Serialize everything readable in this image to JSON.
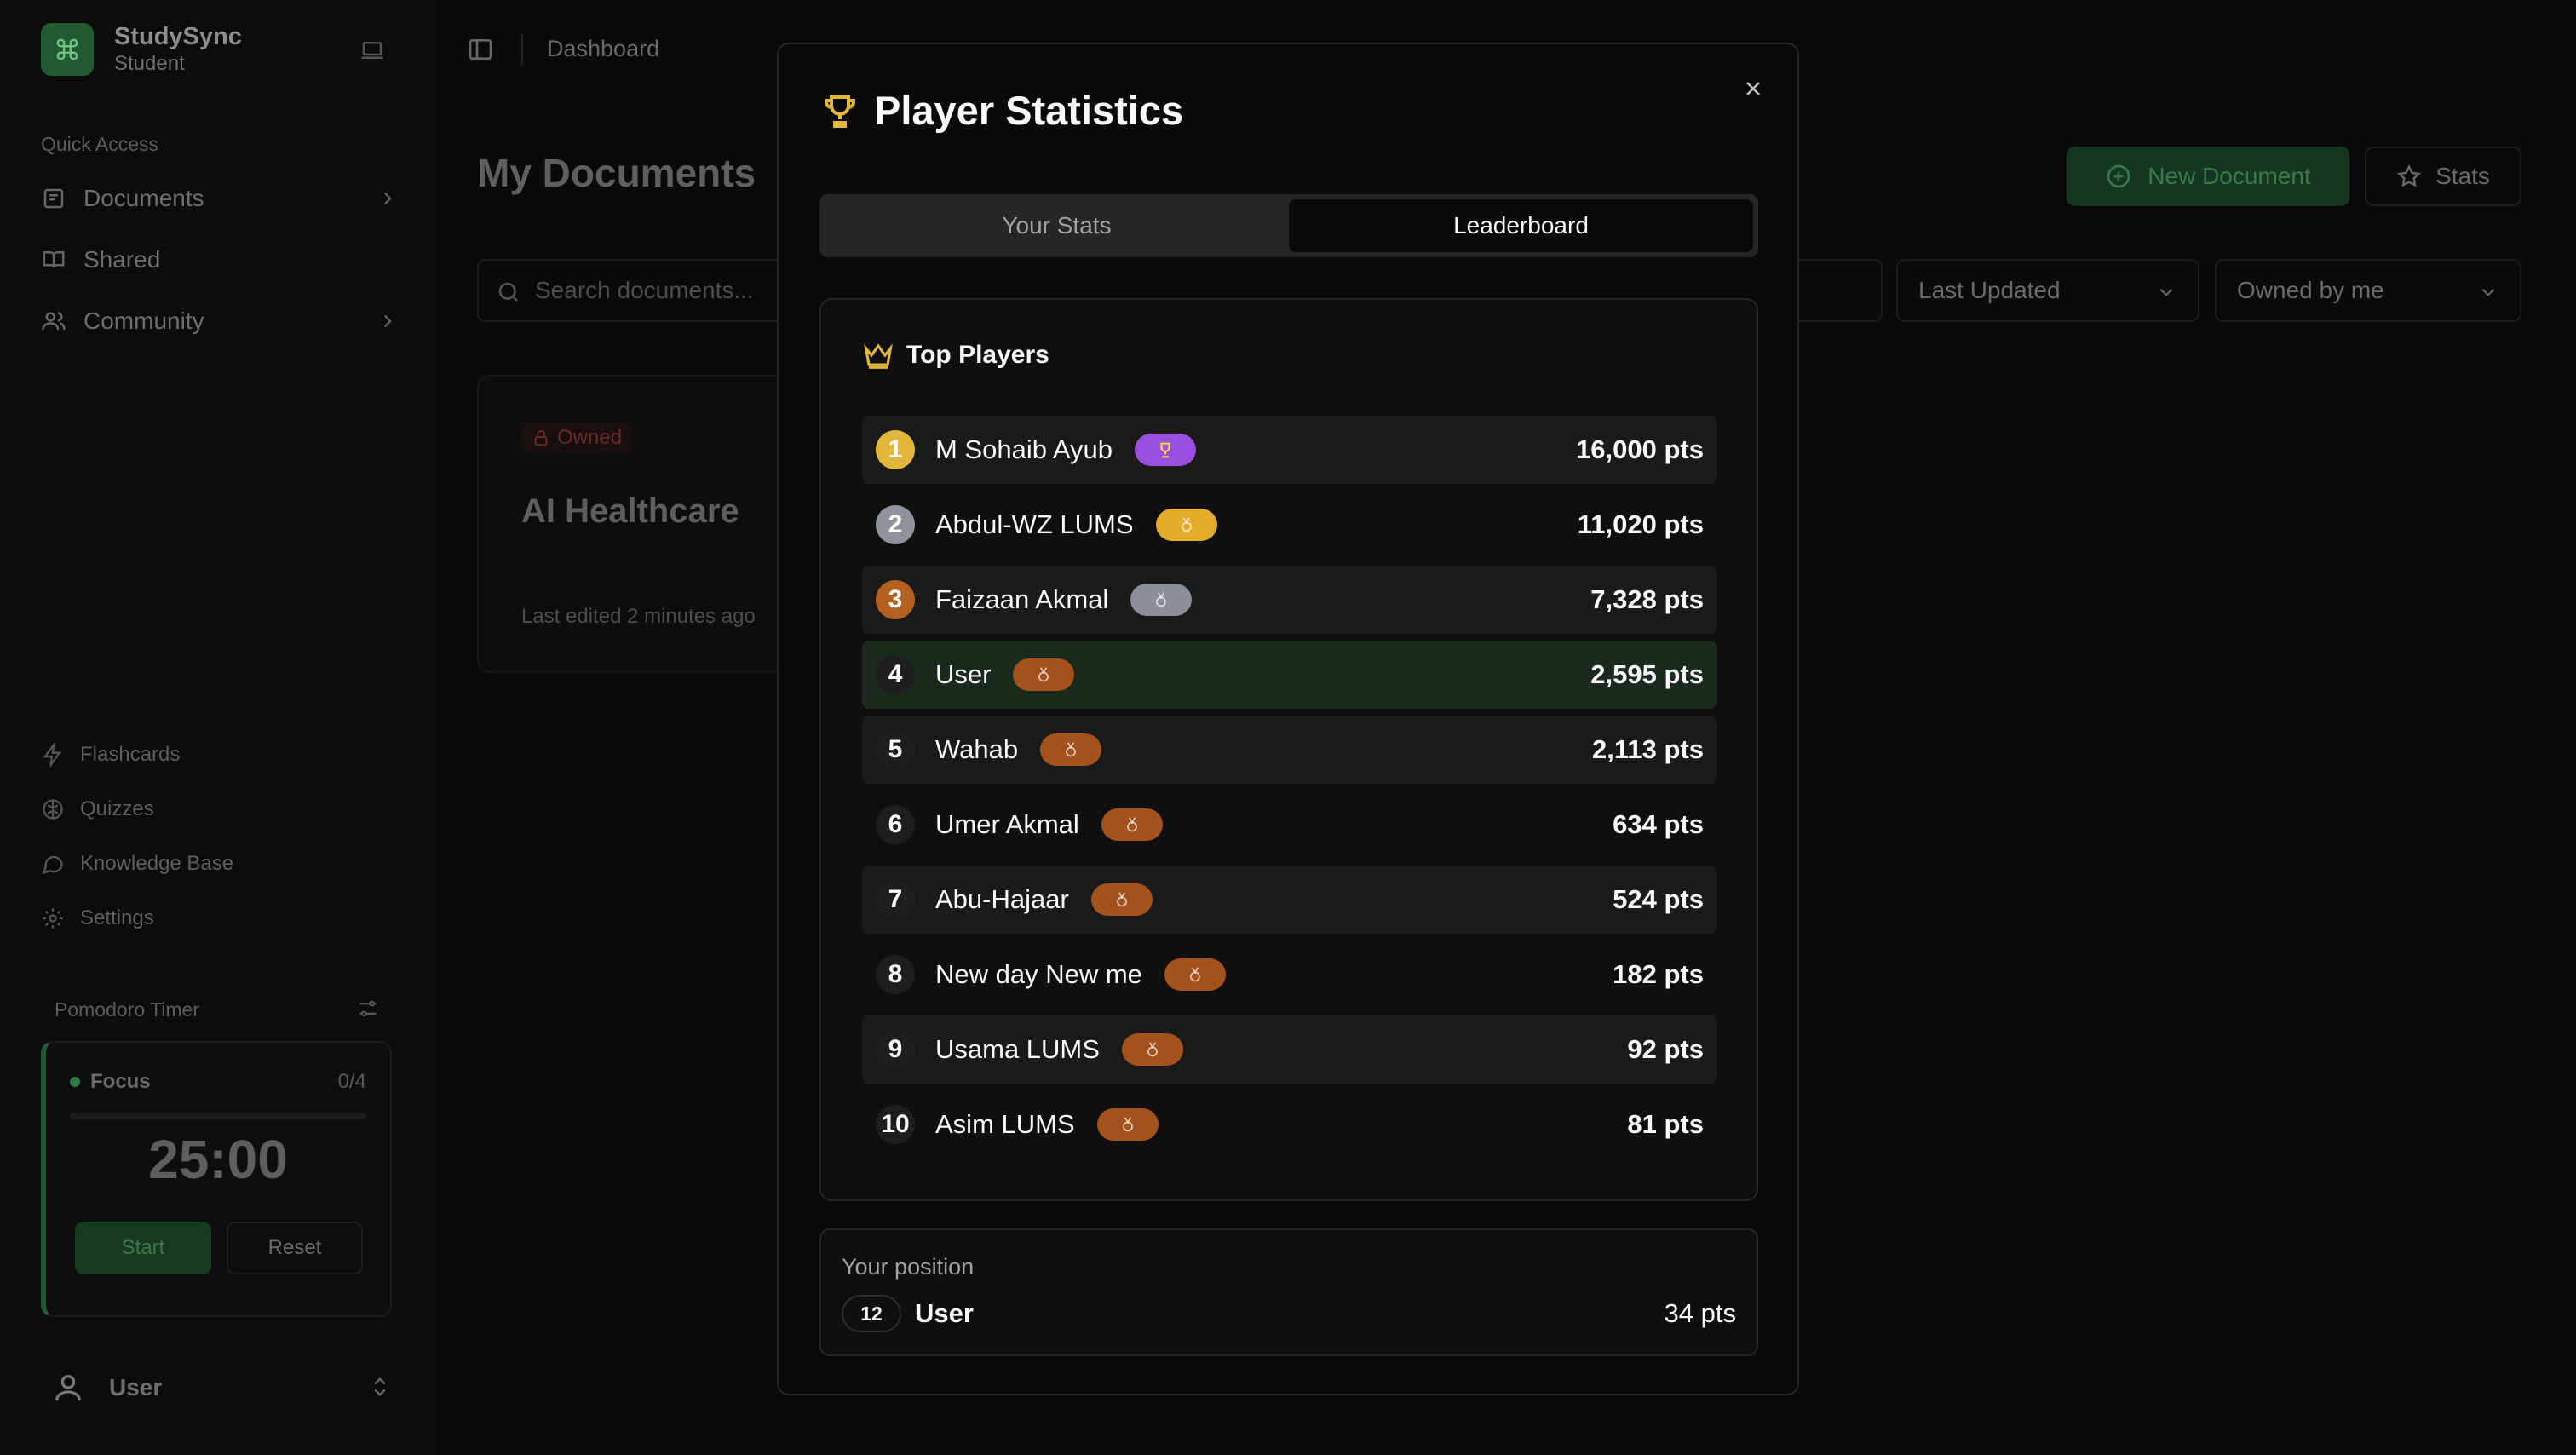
{
  "app": {
    "name": "StudySync",
    "role": "Student"
  },
  "sidebar": {
    "quick_access_label": "Quick Access",
    "nav": [
      {
        "label": "Documents"
      },
      {
        "label": "Shared"
      },
      {
        "label": "Community"
      }
    ],
    "tools": [
      {
        "label": "Flashcards"
      },
      {
        "label": "Quizzes"
      },
      {
        "label": "Knowledge Base"
      },
      {
        "label": "Settings"
      }
    ],
    "pomodoro": {
      "title": "Pomodoro Timer",
      "mode": "Focus",
      "count": "0/4",
      "time": "25:00",
      "start_label": "Start",
      "reset_label": "Reset"
    },
    "user": {
      "name": "User"
    }
  },
  "topbar": {
    "breadcrumb": "Dashboard"
  },
  "main": {
    "title": "My Documents",
    "new_document_label": "New Document",
    "stats_label": "Stats",
    "search_placeholder": "Search documents...",
    "sort_value": "Last Updated",
    "owner_filter_value": "Owned by me",
    "documents": [
      {
        "badge": "Owned",
        "title": "AI Healthcare",
        "edited": "Last edited 2 minutes ago"
      }
    ]
  },
  "modal": {
    "title": "Player Statistics",
    "tabs": [
      {
        "label": "Your Stats",
        "active": false
      },
      {
        "label": "Leaderboard",
        "active": true
      }
    ],
    "leaderboard_title": "Top Players",
    "players": [
      {
        "rank": "1",
        "name": "M Sohaib Ayub",
        "points": "16,000 pts",
        "medal": "gold",
        "badge": "purple"
      },
      {
        "rank": "2",
        "name": "Abdul-WZ LUMS",
        "points": "11,020 pts",
        "medal": "silver",
        "badge": "yellow"
      },
      {
        "rank": "3",
        "name": "Faizaan Akmal",
        "points": "7,328 pts",
        "medal": "bronze",
        "badge": "gray"
      },
      {
        "rank": "4",
        "name": "User",
        "points": "2,595 pts",
        "medal": "plain",
        "badge": "orange"
      },
      {
        "rank": "5",
        "name": "Wahab",
        "points": "2,113 pts",
        "medal": "plain",
        "badge": "orange"
      },
      {
        "rank": "6",
        "name": "Umer Akmal",
        "points": "634 pts",
        "medal": "plain",
        "badge": "orange"
      },
      {
        "rank": "7",
        "name": "Abu-Hajaar",
        "points": "524 pts",
        "medal": "plain",
        "badge": "orange"
      },
      {
        "rank": "8",
        "name": "New day New me",
        "points": "182 pts",
        "medal": "plain",
        "badge": "orange"
      },
      {
        "rank": "9",
        "name": "Usama LUMS",
        "points": "92 pts",
        "medal": "plain",
        "badge": "orange"
      },
      {
        "rank": "10",
        "name": "Asim LUMS",
        "points": "81 pts",
        "medal": "plain",
        "badge": "orange"
      }
    ],
    "your_position": {
      "label": "Your position",
      "rank": "12",
      "name": "User",
      "points": "34 pts"
    }
  },
  "colors": {
    "accent": "#1f5a30",
    "trophy": "#e2b53b",
    "modal_bg": "#0a0a0a"
  }
}
